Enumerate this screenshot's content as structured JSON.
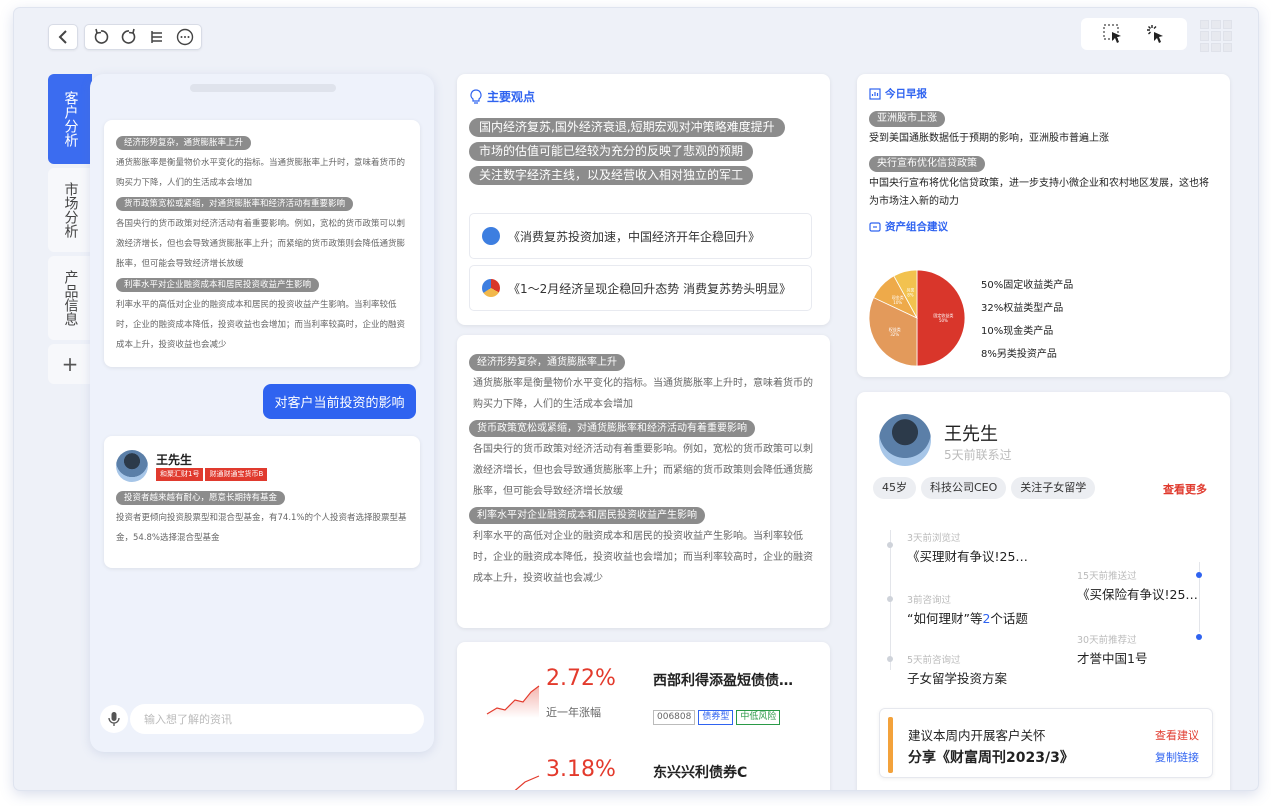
{
  "tabs": [
    {
      "label": "客户分析"
    },
    {
      "label": "市场分析"
    },
    {
      "label": "产品信息"
    }
  ],
  "tab_add": "+",
  "chat": {
    "card1": [
      {
        "tag": "经济形势复杂，通货膨胀率上升",
        "text": "通货膨胀率是衡量物价水平变化的指标。当通货膨胀率上升时，意味着货币的购买力下降，人们的生活成本会增加"
      },
      {
        "tag": "货币政策宽松或紧缩，对通货膨胀率和经济活动有重要影响",
        "text": "各国央行的货币政策对经济活动有着重要影响。例如，宽松的货币政策可以刺激经济增长，但也会导致通货膨胀率上升；而紧缩的货币政策则会降低通货膨胀率，但可能会导致经济增长放缓"
      },
      {
        "tag": "利率水平对企业融资成本和居民投资收益产生影响",
        "text": "利率水平的高低对企业的融资成本和居民的投资收益产生影响。当利率较低时，企业的融资成本降低，投资收益也会增加；而当利率较高时，企业的融资成本上升，投资收益也会减少"
      }
    ],
    "bubble": "对客户当前投资的影响",
    "customer": {
      "name": "王先生",
      "badges": [
        "和聚汇财1号",
        "财通财通宝货币B"
      ],
      "tag": "投资者越来越有耐心，愿意长期持有基金",
      "text": "投资者更倾向投资股票型和混合型基金，有74.1%的个人投资者选择股票型基金，54.8%选择混合型基金"
    },
    "input_placeholder": "输入想了解的资讯"
  },
  "views": {
    "title": "主要观点",
    "points": [
      "国内经济复苏,国外经济衰退,短期宏观对冲策略难度提升",
      "市场的估值可能已经较为充分的反映了悲观的预期",
      "关注数字经济主线，以及经营收入相对独立的军工"
    ],
    "news": [
      "《消费复苏投资加速，中国经济开年企稳回升》",
      "《1～2月经济呈现企稳回升态势 消费复苏势头明显》"
    ]
  },
  "analysis": [
    {
      "tag": "经济形势复杂，通货膨胀率上升",
      "text": "通货膨胀率是衡量物价水平变化的指标。当通货膨胀率上升时，意味着货币的购买力下降，人们的生活成本会增加"
    },
    {
      "tag": "货币政策宽松或紧缩，对通货膨胀率和经济活动有着重要影响",
      "text": "各国央行的货币政策对经济活动有着重要影响。例如，宽松的货币政策可以刺激经济增长，但也会导致通货膨胀率上升；而紧缩的货币政策则会降低通货膨胀率，但可能会导致经济增长放缓"
    },
    {
      "tag": "利率水平对企业融资成本和居民投资收益产生影响",
      "text": "利率水平的高低对企业的融资成本和居民的投资收益产生影响。当利率较低时，企业的融资成本降低，投资收益也会增加；而当利率较高时，企业的融资成本上升，投资收益也会减少"
    }
  ],
  "funds": [
    {
      "pct": "2.72%",
      "label": "近一年涨幅",
      "name": "西部利得添盈短债债…",
      "code": "006808",
      "type": "债券型",
      "risk": "中低风险"
    },
    {
      "pct": "3.18%",
      "name": "东兴兴利债券C"
    }
  ],
  "brief": {
    "title": "今日早报",
    "items": [
      {
        "tag": "亚洲股市上涨",
        "text": "受到美国通胀数据低于预期的影响，亚洲股市普遍上涨"
      },
      {
        "tag": "央行宣布优化信贷政策",
        "text": "中国央行宣布将优化信贷政策，进一步支持小微企业和农村地区发展，这也将为市场注入新的动力"
      }
    ],
    "alloc_title": "资产组合建议"
  },
  "chart_data": {
    "type": "pie",
    "slices": [
      {
        "label": "固定收益类产品",
        "value": 50,
        "color": "#d9362b",
        "inner": "固定收益类",
        "inner_pct": "50%"
      },
      {
        "label": "权益类型产品",
        "value": 32,
        "color": "#e39a5b",
        "inner": "权益类",
        "inner_pct": "32%"
      },
      {
        "label": "现金类产品",
        "value": 10,
        "color": "#eeaa4a",
        "inner": "现金类",
        "inner_pct": "10%"
      },
      {
        "label": "另类投资产品",
        "value": 8,
        "color": "#f2c24f",
        "inner": "另类",
        "inner_pct": "8%"
      }
    ],
    "legend_texts": [
      "50%固定收益类产品",
      "32%权益类型产品",
      "10%现金类产品",
      "8%另类投资产品"
    ]
  },
  "profile": {
    "name": "王先生",
    "last_contact": "5天前联系过",
    "chips": [
      "45岁",
      "科技公司CEO",
      "关注子女留学"
    ],
    "more": "查看更多",
    "timeline": [
      {
        "label": "3天前浏览过",
        "text": "《买理财有争议!25…"
      },
      {
        "label": "15天前推送过",
        "text": "《买保险有争议!25…"
      },
      {
        "label": "3前咨询过",
        "text_pre": "“如何理财”等",
        "num": "2",
        "text_post": "个话题"
      },
      {
        "label": "30天前推荐过",
        "text": "才誉中国1号"
      },
      {
        "label": "5天前咨询过",
        "text": "子女留学投资方案"
      }
    ],
    "suggest": {
      "line1": "建议本周内开展客户关怀",
      "line2": "分享《财富周刊2023/3》",
      "action1": "查看建议",
      "action2": "复制链接"
    }
  },
  "colors": {
    "accent": "#2f63f0",
    "red": "#e03a2e",
    "orange": "#f3a23b"
  }
}
